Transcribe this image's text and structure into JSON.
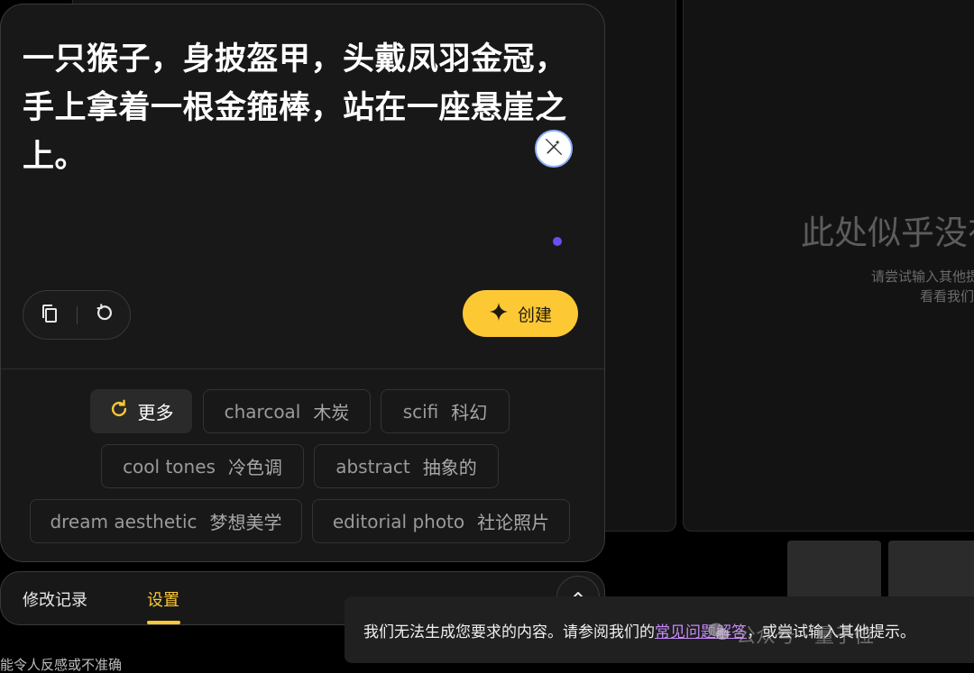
{
  "prompt": {
    "text": "一只猴子，身披盔甲，头戴凤羽金冠，手上拿着一根金箍棒，站在一座悬崖之上。",
    "create_label": "创建"
  },
  "suggestions": {
    "more_label": "更多",
    "chips": [
      {
        "en": "charcoal",
        "zh": "木炭"
      },
      {
        "en": "scifi",
        "zh": "科幻"
      },
      {
        "en": "cool tones",
        "zh": "冷色调"
      },
      {
        "en": "abstract",
        "zh": "抽象的"
      },
      {
        "en": "dream aesthetic",
        "zh": "梦想美学"
      },
      {
        "en": "editorial photo",
        "zh": "社论照片"
      }
    ]
  },
  "tabs": {
    "history": "修改记录",
    "settings": "设置"
  },
  "empty_state": {
    "title": "此处似乎没有",
    "line1": "请尝试输入其他提",
    "line2": "看看我们的"
  },
  "disclaimer": "能令人反感或不准确",
  "toast": {
    "before": "我们无法生成您要求的内容。请参阅我们的",
    "link": "常见问题解答",
    "after": "，或尝试输入其他提示。"
  },
  "watermark": "公众号 · 量子位",
  "colors": {
    "accent": "#fcc934",
    "link": "#c58af9",
    "dot": "#6b4ef0"
  }
}
